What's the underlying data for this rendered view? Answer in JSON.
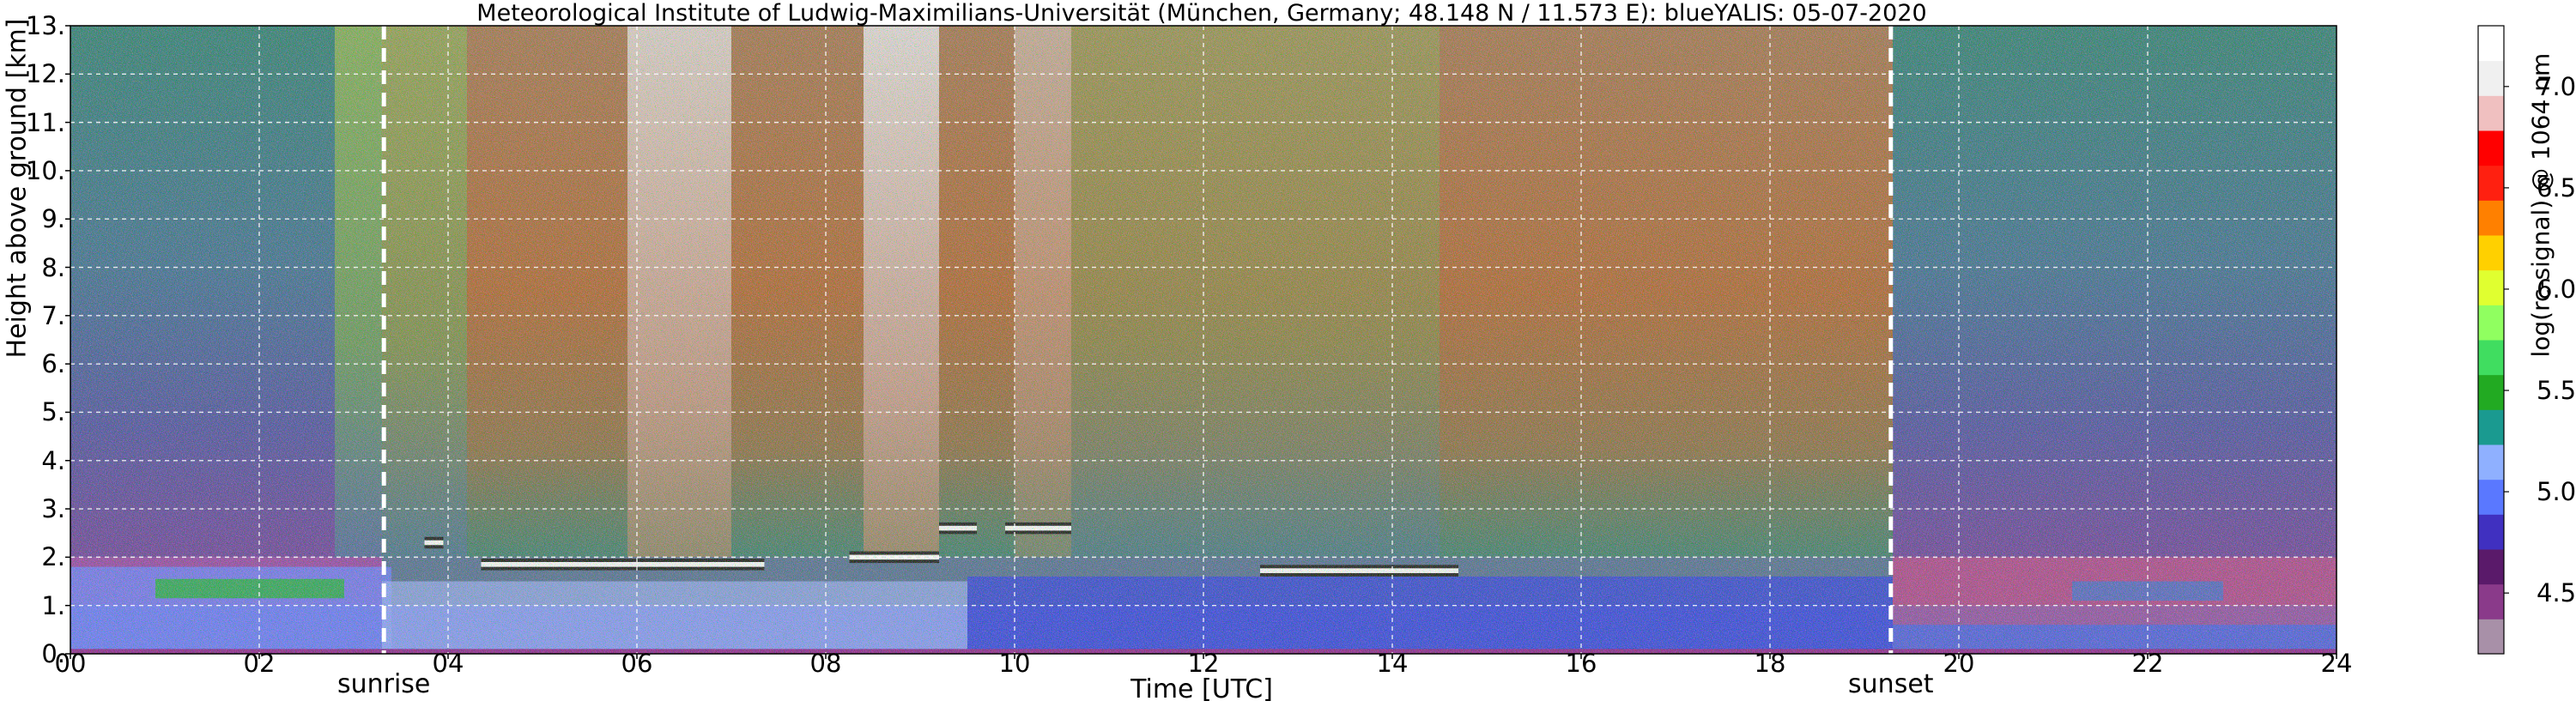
{
  "chart_data": {
    "type": "heatmap",
    "title": "Meteorological Institute of Ludwig-Maximilians-Universität (München, Germany; 48.148 N / 11.573 E):    blueYALIS: 05-07-2020",
    "xlabel": "Time [UTC]",
    "ylabel": "Height above ground [km]",
    "colorbar_label": "log(rc-signal) @ 1064 nm",
    "xlim": [
      0,
      24
    ],
    "ylim": [
      0,
      13
    ],
    "x_ticks": [
      "00",
      "02",
      "04",
      "06",
      "08",
      "10",
      "12",
      "14",
      "16",
      "18",
      "20",
      "22",
      "24"
    ],
    "y_ticks": [
      "0.",
      "1.",
      "2.",
      "3.",
      "4.",
      "5.",
      "6.",
      "7.",
      "8.",
      "9.",
      "10.",
      "11.",
      "12.",
      "13."
    ],
    "colorbar_range": [
      4.2,
      7.3
    ],
    "colorbar_ticks": [
      "4.5",
      "5.0",
      "5.5",
      "6.0",
      "6.5",
      "7.0"
    ],
    "grid": true,
    "events": [
      {
        "label": "sunrise",
        "time": 3.32
      },
      {
        "label": "sunset",
        "time": 19.28
      }
    ],
    "colors": {
      "colormap": [
        "#a890a8",
        "#8a3a8a",
        "#5a1a6a",
        "#4030c0",
        "#5a78ff",
        "#8fb0ff",
        "#1a9a90",
        "#22aa22",
        "#40dd60",
        "#90ff60",
        "#e0ff30",
        "#ffd000",
        "#ff8000",
        "#ff2010",
        "#ff0000",
        "#f0c0c0",
        "#f0f0f0",
        "#ffffff"
      ]
    },
    "features": {
      "cloud_layers": [
        {
          "t0": 3.75,
          "t1": 3.95,
          "height": 2.3
        },
        {
          "t0": 4.35,
          "t1": 7.35,
          "height": 1.85
        },
        {
          "t0": 8.25,
          "t1": 9.2,
          "height": 2.0
        },
        {
          "t0": 9.2,
          "t1": 9.6,
          "height": 2.6
        },
        {
          "t0": 9.9,
          "t1": 10.6,
          "height": 2.6
        },
        {
          "t0": 12.6,
          "t1": 14.7,
          "height": 1.72
        }
      ],
      "boundary_layer_top_km": 1.8,
      "residual_layer_top_km": 2.0
    }
  }
}
